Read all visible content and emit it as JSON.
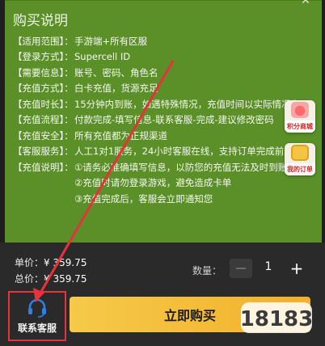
{
  "info": {
    "title": "购买说明",
    "rows": [
      {
        "label": "【适用范围】：",
        "value": "手游端+所有区服"
      },
      {
        "label": "【登录方式】：",
        "value": "Supercell ID"
      },
      {
        "label": "【需要信息】：",
        "value": "账号、密码、角色名"
      },
      {
        "label": "【充值方式】：",
        "value": "白卡充值，货源充足"
      },
      {
        "label": "【充值时长】：",
        "value": "15分钟内到账，如遇特殊情况，充值时间以实际情况为"
      },
      {
        "label": "【充值流程】：",
        "value": "付款完成-填写信息-联系客服-完成-建议修改密码"
      },
      {
        "label": "【充值安全】：",
        "value": "所有充值都为正规渠道"
      },
      {
        "label": "【客服服务】：",
        "value": "人工1对1服务，24小时客服在线，支持订单完成前退"
      },
      {
        "label": "【充值说明】：",
        "value": "①请务必准确填写信息，以防您的充值无法及时到账"
      }
    ],
    "sub_rows": [
      "②充值时请勿登录游戏，避免造成卡单",
      "③充值完成后，客服会立即通知您"
    ]
  },
  "floating": {
    "points_mall": "积分商城",
    "my_orders": "我的订单"
  },
  "bottom": {
    "unit_price_label": "单价：",
    "unit_price_value": "¥ 359.75",
    "total_price_label": "总价：",
    "total_price_value": "¥ 359.75",
    "quantity_label": "数量：",
    "quantity_value": "1",
    "service_label": "联系客服",
    "buy_label": "立即购买"
  },
  "colors": {
    "panel_green": "#5b8f27",
    "buy_yellow": "#f2b12a",
    "highlight_red": "#e6323a"
  },
  "icons": {
    "service": "headset-icon",
    "points": "gift-icon",
    "orders": "order-icon"
  }
}
